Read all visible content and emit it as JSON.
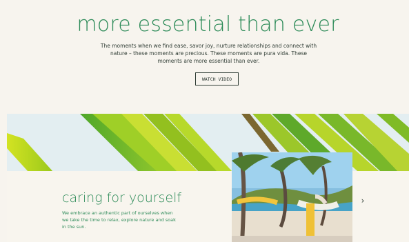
{
  "hero": {
    "title": "more essential than ever",
    "body": "The moments when we find ease, savor joy, nurture relationships and connect with nature – these moments are precious. These moments are pura vida. These moments are more essential than ever.",
    "cta_label": "WATCH VIDEO"
  },
  "section": {
    "title": "caring for yourself",
    "body": "We embrace an authentic part of ourselves when we take the time to relax, explore nature and soak in the sun."
  },
  "carousel": {
    "next_icon": "chevron-right-icon"
  },
  "colors": {
    "brand_green": "#2b8a57",
    "page_background": "#f7f4ee"
  }
}
